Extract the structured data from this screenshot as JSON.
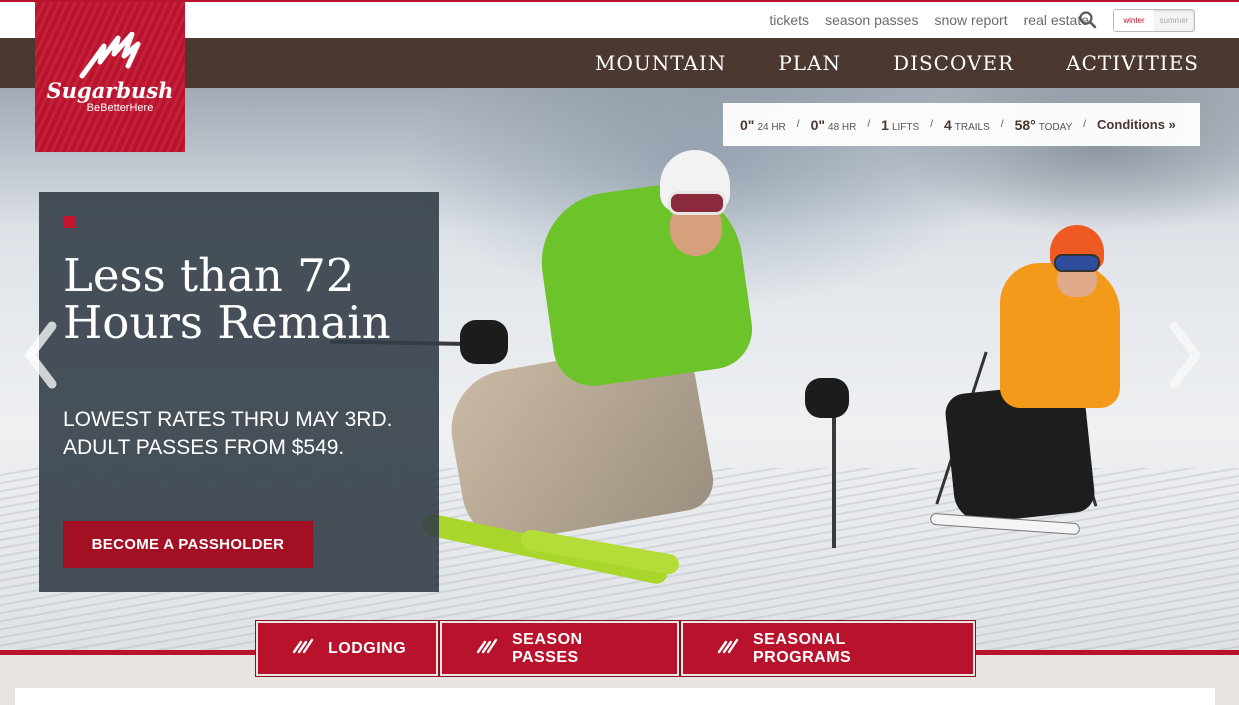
{
  "brand": {
    "name": "Sugarbush",
    "tagline": "BeBetterHere",
    "accent": "#b8122c",
    "nav_color": "#4b3830"
  },
  "utility_nav": {
    "links": [
      "tickets",
      "season passes",
      "snow report",
      "real estate"
    ],
    "search_icon": "search-icon",
    "season_toggle": {
      "winter": "winter",
      "summer": "summer",
      "selected": "winter"
    }
  },
  "main_nav": {
    "items": [
      "MOUNTAIN",
      "PLAN",
      "DISCOVER",
      "ACTIVITIES"
    ]
  },
  "conditions": {
    "snow_24": {
      "value": "0\"",
      "unit": "24 HR"
    },
    "snow_48": {
      "value": "0\"",
      "unit": "48 HR"
    },
    "lifts": {
      "value": "1",
      "unit": "LIFTS"
    },
    "trails": {
      "value": "4",
      "unit": "TRAILS"
    },
    "temp": {
      "value": "58°",
      "unit": "TODAY"
    },
    "separator": "/",
    "link": "Conditions »"
  },
  "promo": {
    "title": "Less than 72 Hours Remain",
    "subtitle": "Lowest rates thru May 3rd. Adult passes from $549.",
    "cta": "BECOME A PASSHOLDER"
  },
  "carousel": {
    "prev_icon": "chevron-left-icon",
    "next_icon": "chevron-right-icon"
  },
  "quick_links": [
    "LODGING",
    "SEASON PASSES",
    "SEASONAL PROGRAMS"
  ]
}
